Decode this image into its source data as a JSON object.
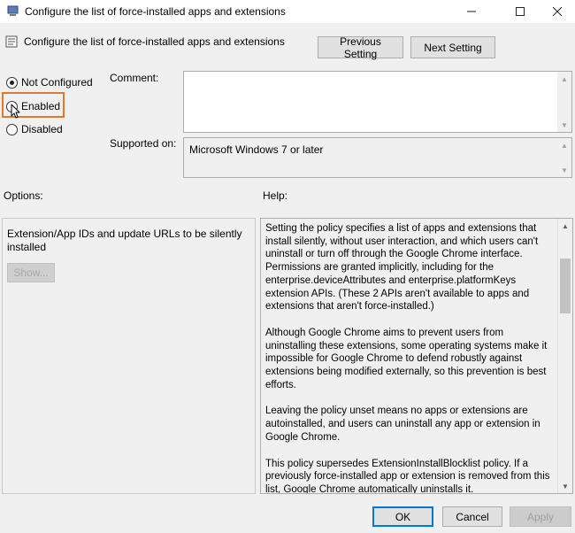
{
  "window": {
    "title": "Configure the list of force-installed apps and extensions",
    "minimize_icon": "minimize-icon",
    "maximize_icon": "maximize-icon",
    "close_icon": "close-icon"
  },
  "header": {
    "setting_name": "Configure the list of force-installed apps and extensions",
    "previous_label": "Previous Setting",
    "next_label": "Next Setting"
  },
  "state": {
    "options": [
      {
        "label": "Not Configured",
        "checked": true
      },
      {
        "label": "Enabled",
        "checked": false,
        "highlighted": true
      },
      {
        "label": "Disabled",
        "checked": false
      }
    ],
    "highlight_color": "#e07a2a"
  },
  "comment": {
    "label": "Comment:",
    "value": ""
  },
  "supported": {
    "label": "Supported on:",
    "value": "Microsoft Windows 7 or later"
  },
  "options_panel": {
    "label": "Options:",
    "description": "Extension/App IDs and update URLs to be silently installed",
    "show_label": "Show..."
  },
  "help": {
    "label": "Help:",
    "paragraphs": [
      "Setting the policy specifies a list of apps and extensions that install silently, without user interaction, and which users can't uninstall or turn off through the Google Chrome interface. Permissions are granted implicitly, including for the enterprise.deviceAttributes and enterprise.platformKeys extension APIs. (These 2 APIs aren't available to apps and extensions that aren't force-installed.)",
      "Although Google Chrome aims to prevent users from uninstalling these extensions, some operating systems make it impossible for Google Chrome to defend robustly against extensions being modified externally, so this prevention is best efforts.",
      "Leaving the policy unset means no apps or extensions are autoinstalled, and users can uninstall any app or extension in Google Chrome.",
      "This policy supersedes ExtensionInstallBlocklist policy. If a previously force-installed app or extension is removed from this list, Google Chrome automatically uninstalls it."
    ]
  },
  "footer": {
    "ok_label": "OK",
    "cancel_label": "Cancel",
    "apply_label": "Apply"
  }
}
